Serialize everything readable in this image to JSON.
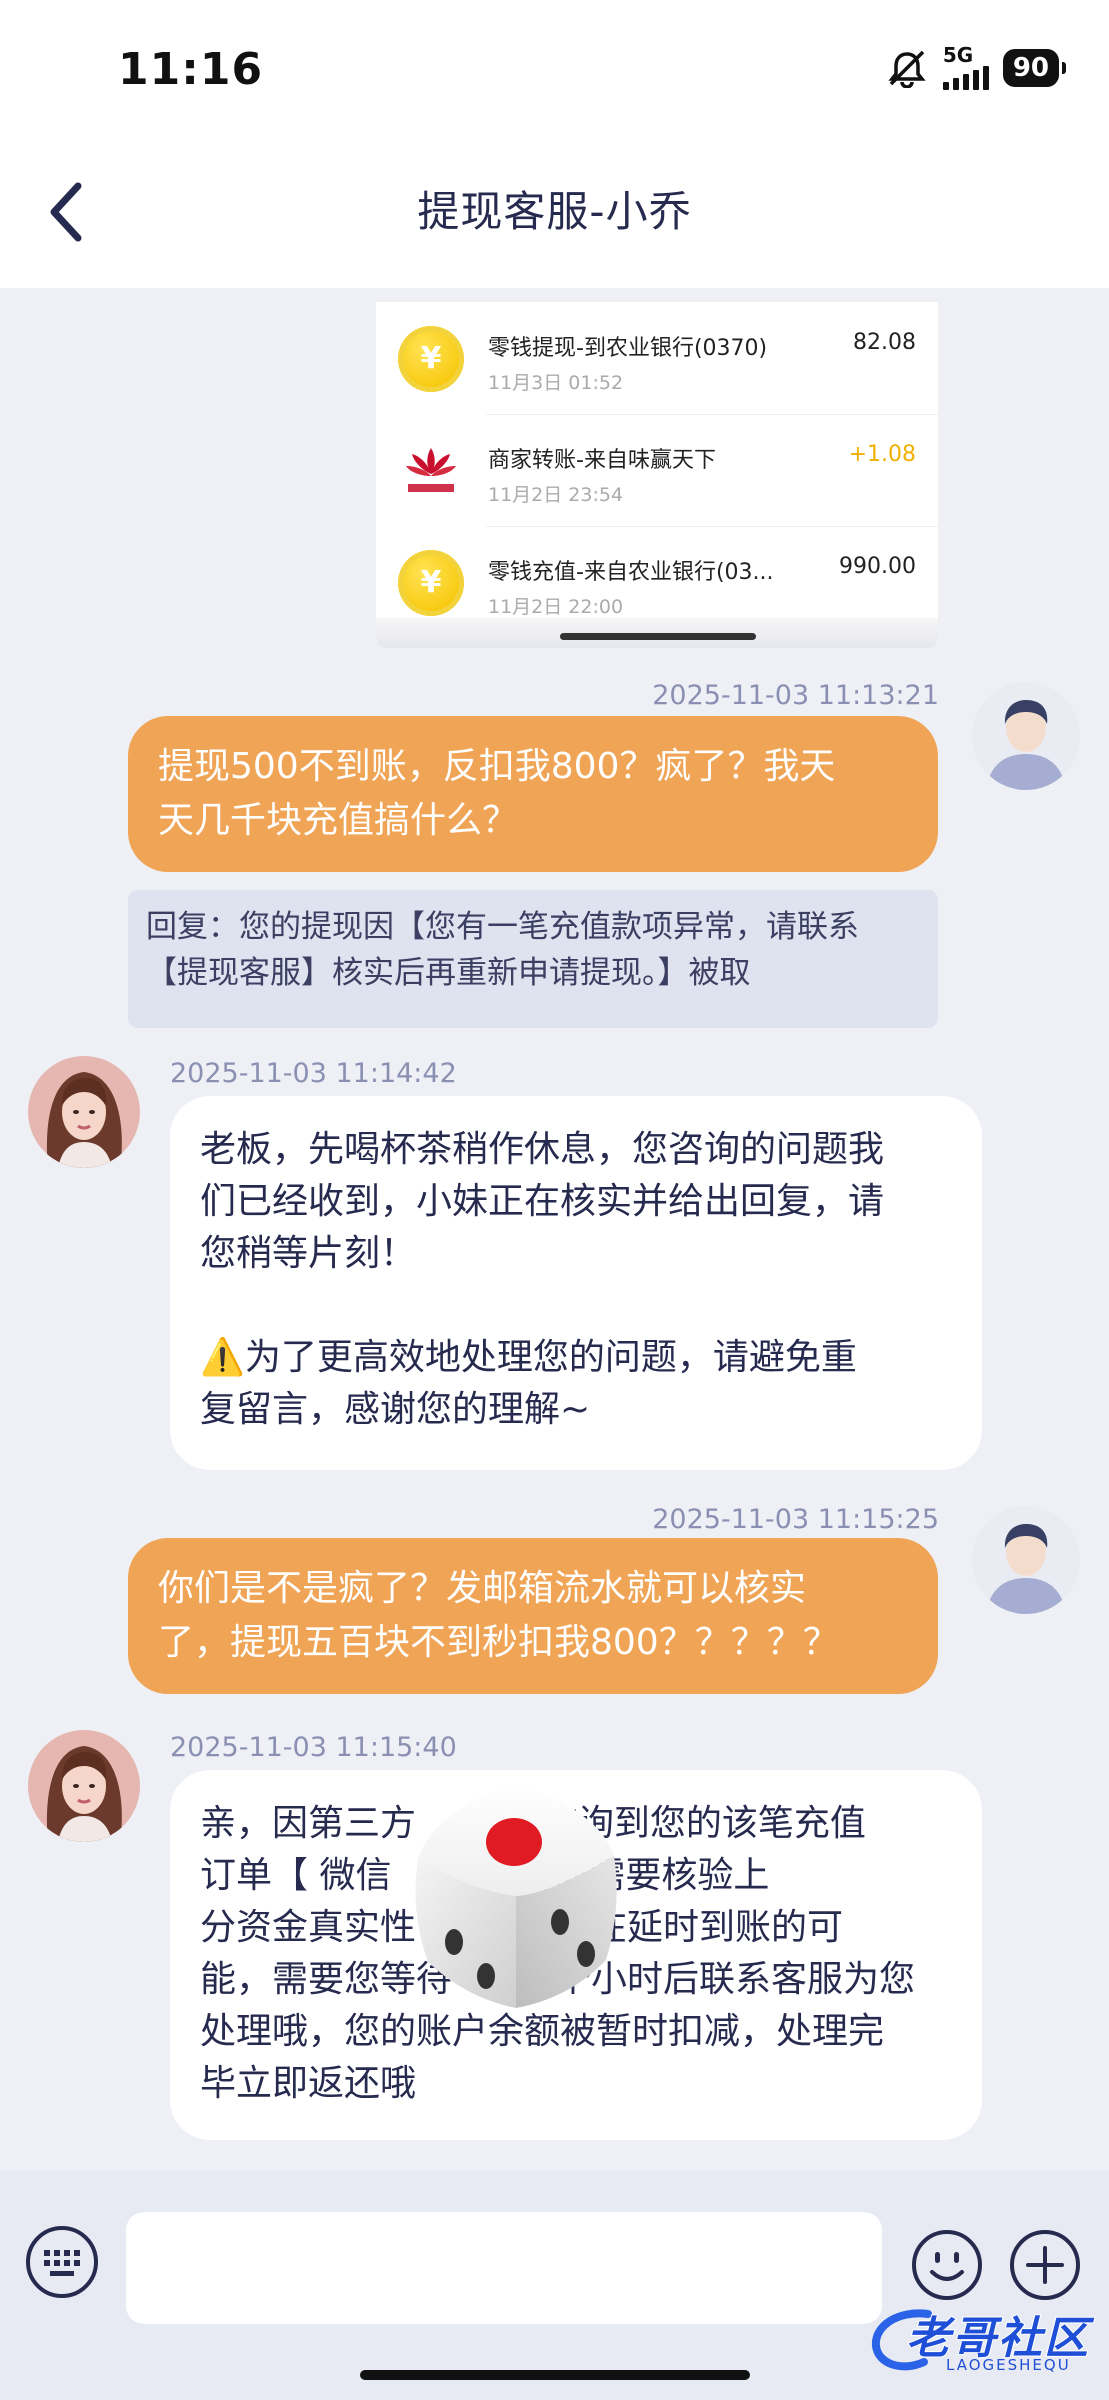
{
  "status_bar": {
    "time": "11:16",
    "network": "5G",
    "battery": "90"
  },
  "header": {
    "title": "提现客服-小乔"
  },
  "transactions": [
    {
      "name": "零钱提现-到农业银行(0370)",
      "date": "11月3日 01:52",
      "amount": "82.08",
      "icon": "coin-icon",
      "income": false
    },
    {
      "name": "商家转账-来自味赢天下",
      "date": "11月2日 23:54",
      "amount": "+1.08",
      "icon": "merchant-logo",
      "income": true
    },
    {
      "name": "零钱充值-来自农业银行(03...",
      "date": "11月2日 22:00",
      "amount": "990.00",
      "icon": "coin-icon",
      "income": false
    }
  ],
  "messages": [
    {
      "from": "user",
      "time": "2025-11-03 11:13:21",
      "lines": [
        "提现500不到账，反扣我800？疯了？我天",
        "天几千块充值搞什么？"
      ],
      "quote": "回复：您的提现因【您有一笔充值款项异常，请联系\n【提现客服】核实后再重新申请提现。】被取"
    },
    {
      "from": "agent",
      "time": "2025-11-03 11:14:42",
      "text": "老板，先喝杯茶稍作休息，您咨询的问题我\n们已经收到，小妹正在核实并给出回复，请\n您稍等片刻！\n\n⚠️为了更高效地处理您的问题，请避免重\n复留言，感谢您的理解~"
    },
    {
      "from": "user",
      "time": "2025-11-03 11:15:25",
      "lines": [
        "你们是不是疯了？发邮箱流水就可以核实",
        "了，提现五百块不到秒扣我800？？？？？"
      ]
    },
    {
      "from": "agent",
      "time": "2025-11-03 11:15:40",
      "text": "亲，因第三方           查询到您的该笔充值\n订单【 微信           目前需要核验上\n分资金真实性         信存在延时到账的可\n能，需要您等待         个小时后联系客服为您\n处理哦，您的账户余额被暂时扣减，处理完\n毕立即返还哦"
    }
  ],
  "input": {
    "placeholder": ""
  },
  "watermark": {
    "text": "老哥社区",
    "sub": "LAOGESHEQU"
  },
  "colors": {
    "outgoing_bubble": "#f0a455",
    "incoming_bubble": "#ffffff",
    "background": "#eef0f6",
    "title": "#262a4e"
  }
}
